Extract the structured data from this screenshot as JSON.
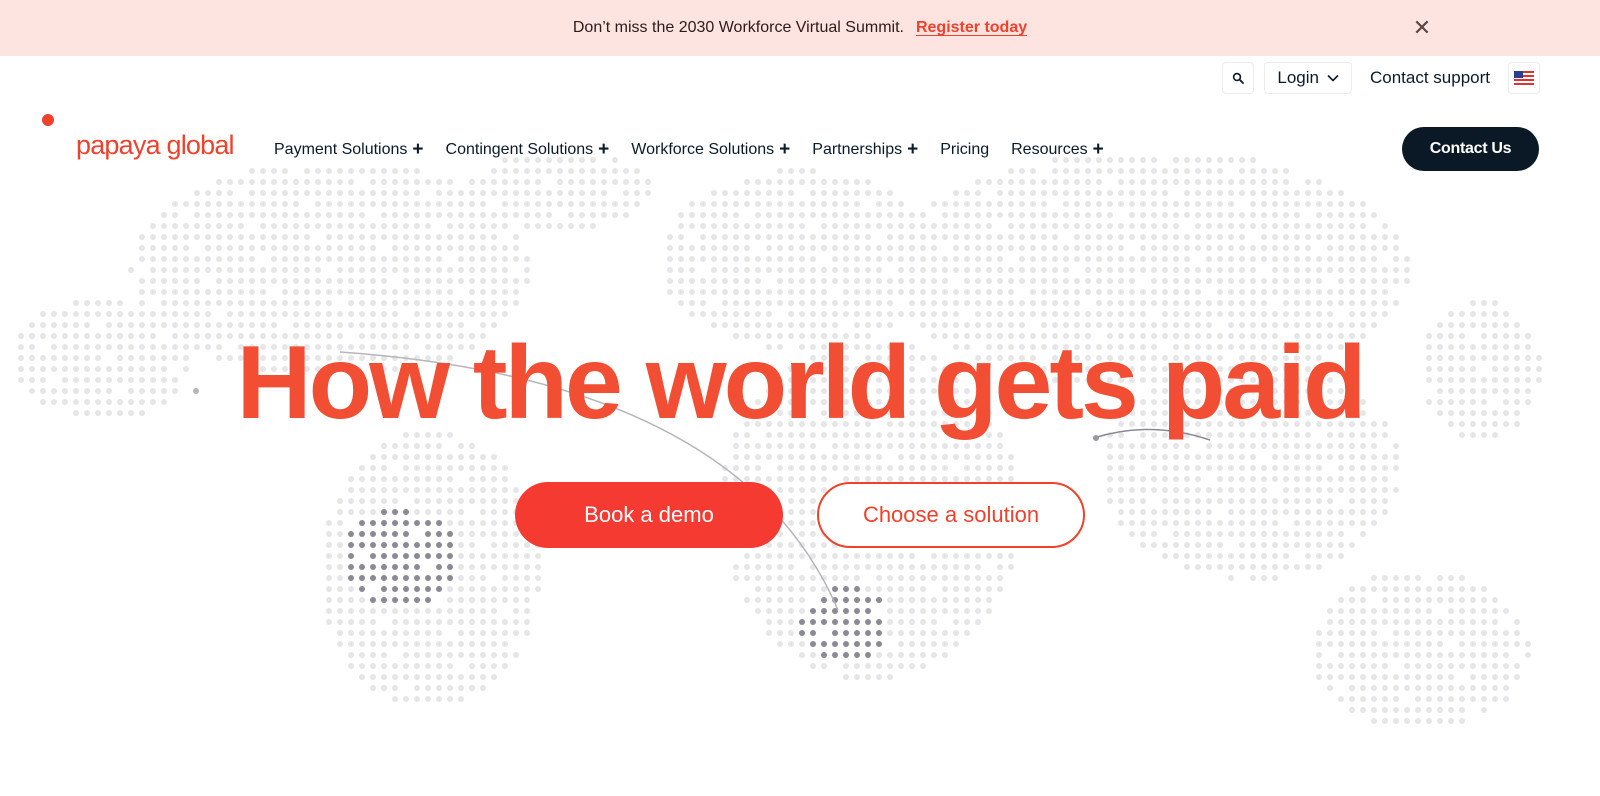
{
  "banner": {
    "text": "Don’t miss the 2030 Workforce Virtual Summit.",
    "link": "Register today",
    "close_icon": "close-icon"
  },
  "utility": {
    "search_icon": "search-icon",
    "login_label": "Login",
    "support_label": "Contact support",
    "flag_icon": "us-flag-icon"
  },
  "brand": {
    "logo_text": "papaya global",
    "accent": "#f0412d"
  },
  "nav": {
    "items": [
      {
        "label": "Payment Solutions",
        "has_plus": true
      },
      {
        "label": "Contingent Solutions",
        "has_plus": true
      },
      {
        "label": "Workforce Solutions",
        "has_plus": true
      },
      {
        "label": "Partnerships",
        "has_plus": true
      },
      {
        "label": "Pricing",
        "has_plus": false
      },
      {
        "label": "Resources",
        "has_plus": true
      }
    ],
    "cta_label": "Contact Us"
  },
  "hero": {
    "title": "How the world gets paid",
    "primary_button": "Book a demo",
    "secondary_button": "Choose a solution"
  },
  "colors": {
    "banner_bg": "#fde4e1",
    "primary": "#f53a32",
    "dark": "#0b1926",
    "map_dot": "#e6e6e8",
    "map_dot_dark": "#8b8a94"
  }
}
